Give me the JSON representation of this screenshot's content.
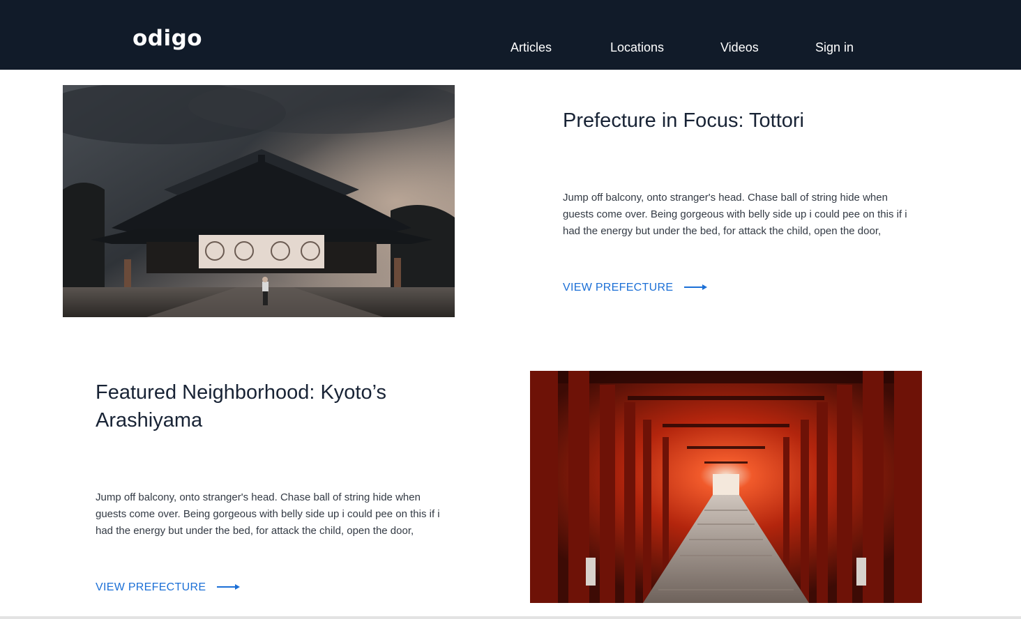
{
  "header": {
    "logo": "odigo",
    "nav": [
      {
        "label": "Articles"
      },
      {
        "label": "Locations"
      },
      {
        "label": "Videos"
      },
      {
        "label": "Sign in"
      }
    ]
  },
  "features": [
    {
      "title": "Prefecture in Focus: Tottori",
      "description": "Jump off balcony, onto stranger's head. Chase ball of string hide when guests come over. Being gorgeous with belly side up i could pee on this if i had the energy but under the bed, for attack the child, open the door,",
      "cta": "VIEW PREFECTURE",
      "image": "shrine-photo"
    },
    {
      "title": "Featured Neighborhood: Kyoto’s Arashiyama",
      "description": "Jump off balcony, onto stranger's head. Chase ball of string hide when guests come over. Being gorgeous with belly side up i could pee on this if i had the energy but under the bed, for attack the child, open the door,",
      "cta": "VIEW PREFECTURE",
      "image": "torii-gates-photo"
    }
  ],
  "colors": {
    "header_bg": "#111b29",
    "accent": "#1b6fd6",
    "title_text": "#182335"
  },
  "icons": {
    "cta_arrow": "arrow-right-icon"
  }
}
